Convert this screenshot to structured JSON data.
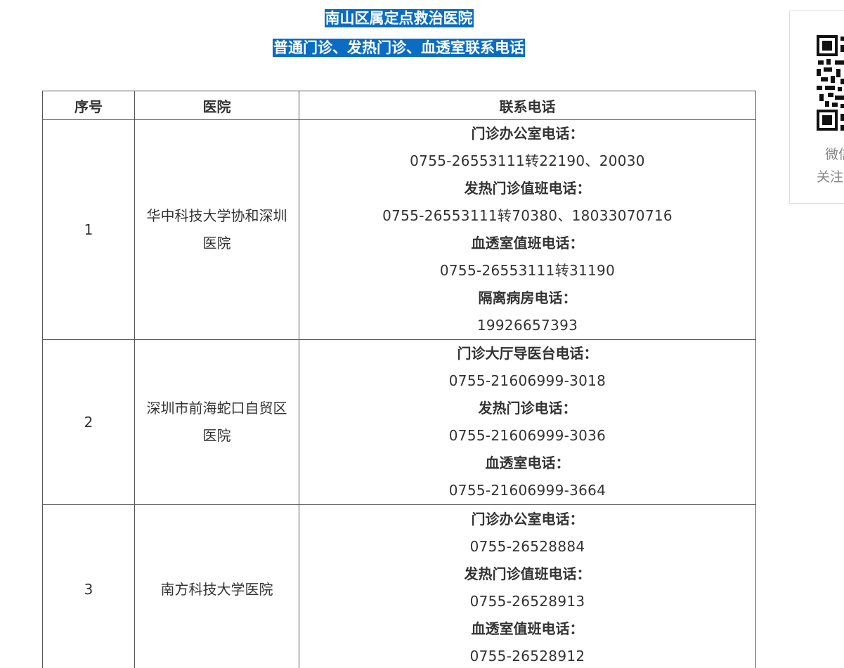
{
  "titles": {
    "line1": "南山区属定点救治医院",
    "line2": "普通门诊、发热门诊、血透室联系电话"
  },
  "table": {
    "headers": {
      "num": "序号",
      "hospital": "医院",
      "phone": "联系电话"
    },
    "rows": [
      {
        "num": "1",
        "hospital": "华中科技大学协和深圳医院",
        "lines": [
          {
            "label": "门诊办公室电话："
          },
          {
            "value": "0755-26553111转22190、20030"
          },
          {
            "label": "发热门诊值班电话："
          },
          {
            "value": "0755-26553111转70380、18033070716"
          },
          {
            "label": "血透室值班电话："
          },
          {
            "value": "0755-26553111转31190"
          },
          {
            "label": "隔离病房电话："
          },
          {
            "value": "19926657393"
          }
        ]
      },
      {
        "num": "2",
        "hospital": "深圳市前海蛇口自贸区医院",
        "lines": [
          {
            "label": "门诊大厅导医台电话："
          },
          {
            "value": "0755-21606999-3018"
          },
          {
            "label": "发热门诊电话："
          },
          {
            "value": "0755-21606999-3036"
          },
          {
            "label": "血透室电话："
          },
          {
            "value": "0755-21606999-3664"
          }
        ]
      },
      {
        "num": "3",
        "hospital": "南方科技大学医院",
        "lines": [
          {
            "label": "门诊办公室电话："
          },
          {
            "value": "0755-26528884"
          },
          {
            "label": "发热门诊值班电话："
          },
          {
            "value": "0755-26528913"
          },
          {
            "label": "血透室值班电话："
          },
          {
            "value": "0755-26528912"
          }
        ]
      }
    ]
  },
  "qr_panel": {
    "caption_line1": "微信",
    "caption_line2": "关注"
  }
}
